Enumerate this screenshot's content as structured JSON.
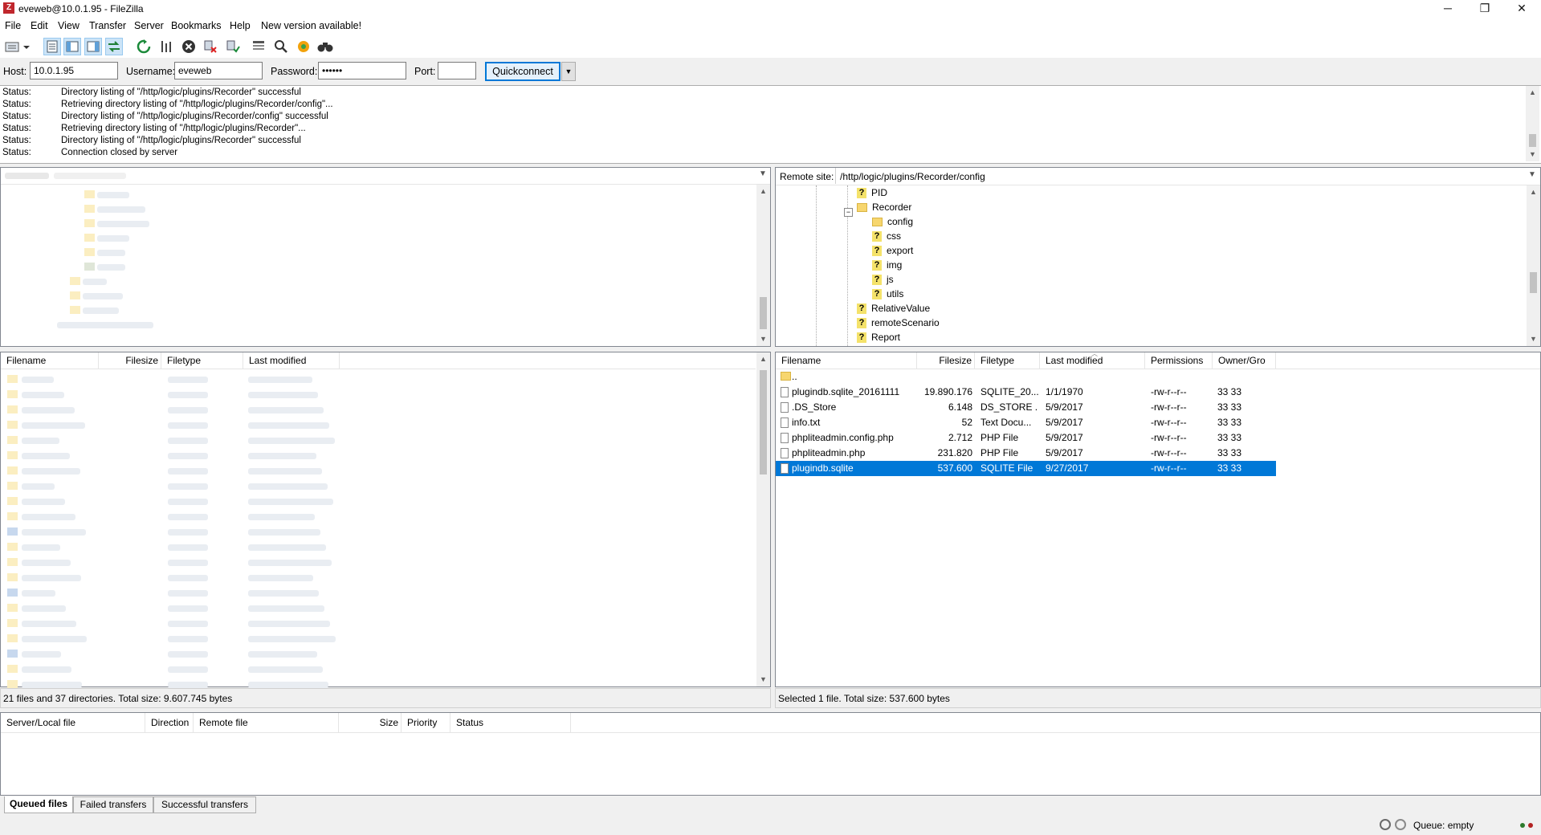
{
  "window": {
    "title": "eveweb@10.0.1.95 - FileZilla",
    "minimize": "─",
    "restore": "❐",
    "close": "✕"
  },
  "menu": [
    "File",
    "Edit",
    "View",
    "Transfer",
    "Server",
    "Bookmarks",
    "Help",
    "New version available!"
  ],
  "quickconnect": {
    "host_label": "Host:",
    "host": "10.0.1.95",
    "username_label": "Username:",
    "username": "eveweb",
    "password_label": "Password:",
    "password": "••••••",
    "port_label": "Port:",
    "port": "",
    "button": "Quickconnect",
    "dropdown": "▼"
  },
  "log": [
    {
      "label": "Status:",
      "text": "Directory listing of \"/http/logic/plugins/Recorder\" successful"
    },
    {
      "label": "Status:",
      "text": "Retrieving directory listing of \"/http/logic/plugins/Recorder/config\"..."
    },
    {
      "label": "Status:",
      "text": "Directory listing of \"/http/logic/plugins/Recorder/config\" successful"
    },
    {
      "label": "Status:",
      "text": "Retrieving directory listing of \"/http/logic/plugins/Recorder\"..."
    },
    {
      "label": "Status:",
      "text": "Directory listing of \"/http/logic/plugins/Recorder\" successful"
    },
    {
      "label": "Status:",
      "text": "Connection closed by server"
    }
  ],
  "remote": {
    "site_label": "Remote site:",
    "site_path": "/http/logic/plugins/Recorder/config",
    "tree": [
      {
        "name": "PID",
        "type": "unknown",
        "level": 0
      },
      {
        "name": "Recorder",
        "type": "folder-open",
        "level": 0
      },
      {
        "name": "config",
        "type": "folder",
        "level": 1
      },
      {
        "name": "css",
        "type": "unknown",
        "level": 1
      },
      {
        "name": "export",
        "type": "unknown",
        "level": 1
      },
      {
        "name": "img",
        "type": "unknown",
        "level": 1
      },
      {
        "name": "js",
        "type": "unknown",
        "level": 1
      },
      {
        "name": "utils",
        "type": "unknown",
        "level": 1
      },
      {
        "name": "RelativeValue",
        "type": "unknown",
        "level": 0
      },
      {
        "name": "remoteScenario",
        "type": "unknown",
        "level": 0
      },
      {
        "name": "Report",
        "type": "unknown",
        "level": 0
      }
    ],
    "columns": [
      "Filename",
      "Filesize",
      "Filetype",
      "Last modified",
      "Permissions",
      "Owner/Gro"
    ],
    "files": [
      {
        "name": "..",
        "size": "",
        "type": "",
        "modified": "",
        "perms": "",
        "owner": "",
        "icon": "folder"
      },
      {
        "name": "plugindb.sqlite_20161111",
        "size": "19.890.176",
        "type": "SQLITE_20...",
        "modified": "1/1/1970",
        "perms": "-rw-r--r--",
        "owner": "33 33",
        "icon": "file"
      },
      {
        "name": ".DS_Store",
        "size": "6.148",
        "type": "DS_STORE ...",
        "modified": "5/9/2017",
        "perms": "-rw-r--r--",
        "owner": "33 33",
        "icon": "file"
      },
      {
        "name": "info.txt",
        "size": "52",
        "type": "Text Docu...",
        "modified": "5/9/2017",
        "perms": "-rw-r--r--",
        "owner": "33 33",
        "icon": "file"
      },
      {
        "name": "phpliteadmin.config.php",
        "size": "2.712",
        "type": "PHP File",
        "modified": "5/9/2017",
        "perms": "-rw-r--r--",
        "owner": "33 33",
        "icon": "file"
      },
      {
        "name": "phpliteadmin.php",
        "size": "231.820",
        "type": "PHP File",
        "modified": "5/9/2017",
        "perms": "-rw-r--r--",
        "owner": "33 33",
        "icon": "file"
      },
      {
        "name": "plugindb.sqlite",
        "size": "537.600",
        "type": "SQLITE File",
        "modified": "9/27/2017",
        "perms": "-rw-r--r--",
        "owner": "33 33",
        "icon": "file",
        "selected": true
      }
    ],
    "status": "Selected 1 file. Total size: 537.600 bytes"
  },
  "local": {
    "columns": [
      "Filename",
      "Filesize",
      "Filetype",
      "Last modified"
    ],
    "status": "21 files and 37 directories. Total size: 9.607.745 bytes"
  },
  "queue": {
    "columns": [
      "Server/Local file",
      "Direction",
      "Remote file",
      "Size",
      "Priority",
      "Status"
    ],
    "tabs": [
      "Queued files",
      "Failed transfers",
      "Successful transfers"
    ],
    "status": "Queue: empty"
  },
  "colors": {
    "selection": "#0078d7",
    "accent": "#0078d7"
  }
}
